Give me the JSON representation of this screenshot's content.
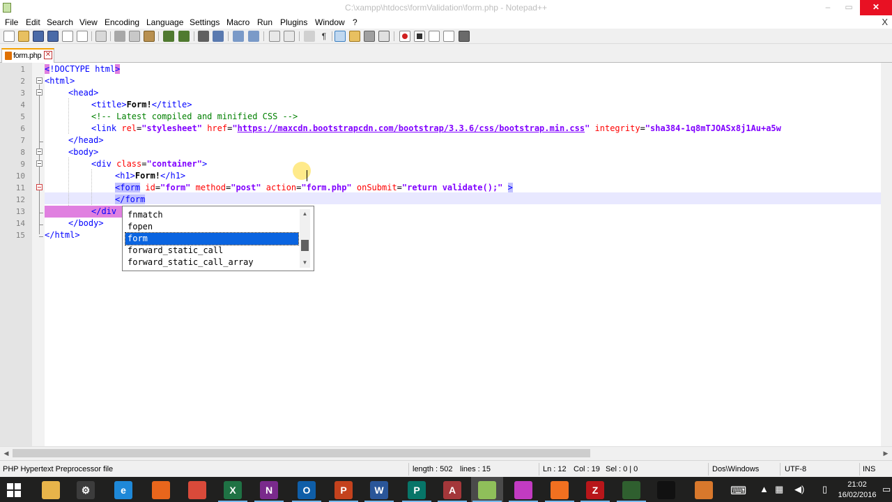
{
  "window": {
    "title": "C:\\xampp\\htdocs\\formValidation\\form.php - Notepad++",
    "min": "–",
    "max": "▭",
    "close": "✕"
  },
  "menu": {
    "items": [
      "File",
      "Edit",
      "Search",
      "View",
      "Encoding",
      "Language",
      "Settings",
      "Macro",
      "Run",
      "Plugins",
      "Window",
      "?"
    ],
    "close_x": "X"
  },
  "toolbar": {
    "icons": [
      "new-file-icon",
      "open-file-icon",
      "save-icon",
      "save-all-icon",
      "close-icon",
      "close-all-icon",
      "print-icon",
      "cut-icon",
      "copy-icon",
      "paste-icon",
      "undo-icon",
      "redo-icon",
      "find-icon",
      "replace-icon",
      "zoom-in-icon",
      "zoom-out-icon",
      "sync-v-icon",
      "sync-h-icon",
      "word-wrap-icon",
      "show-all-chars-icon",
      "indent-guide-icon",
      "user-lang-icon",
      "doc-map-icon",
      "function-list-icon",
      "folder-as-workspace-icon",
      "monitoring-icon",
      "record-macro-icon",
      "stop-macro-icon",
      "play-macro-icon",
      "run-macro-multiple-icon",
      "save-macro-icon"
    ]
  },
  "tab": {
    "label": "form.php",
    "close": "✕"
  },
  "editor": {
    "line_numbers": [
      "1",
      "2",
      "3",
      "4",
      "5",
      "6",
      "7",
      "8",
      "9",
      "10",
      "11",
      "12",
      "13",
      "14",
      "15"
    ],
    "lines": {
      "l1": {
        "open": "<",
        "doctype": "!DOCTYPE html",
        "close": ">"
      },
      "l2": "<html>",
      "l3": "<head>",
      "l4": {
        "open": "<title>",
        "text": "Form!",
        "close": "</title>"
      },
      "l5": "<!-- Latest compiled and minified CSS -->",
      "l6": {
        "tag": "<link ",
        "attr1": "rel",
        "eq1": "=",
        "val1": "\"stylesheet\"",
        "attr2": " href",
        "eq2": "=",
        "q1": "\"",
        "url": "https://maxcdn.bootstrapcdn.com/bootstrap/3.3.6/css/bootstrap.min.css",
        "q2": "\"",
        "attr3": " integrity",
        "eq3": "=",
        "val3": "\"sha384-1q8mTJOASx8j1Au+a5w"
      },
      "l7": "</head>",
      "l8": "<body>",
      "l9": {
        "tag": "<div ",
        "attr": "class",
        "eq": "=",
        "val": "\"container\"",
        "close": ">"
      },
      "l10": {
        "open": "<h1>",
        "text": "Form!",
        "close": "</h1>"
      },
      "l11": {
        "tag": "<form",
        "attr1": " id",
        "eq1": "=",
        "val1": "\"form\"",
        "attr2": " method",
        "eq2": "=",
        "val2": "\"post\"",
        "attr3": " action",
        "eq3": "=",
        "val3": "\"form.php\"",
        "attr4": " onSubmit",
        "eq4": "=",
        "val4": "\"return validate();\"",
        "close": ">"
      },
      "l12": "</form",
      "l13": "</div",
      "l14": "</body>",
      "l15": "</html>"
    }
  },
  "autocomplete": {
    "items": [
      "fnmatch",
      "fopen",
      "form",
      "forward_static_call",
      "forward_static_call_array"
    ],
    "selected": "form",
    "up": "▲",
    "down": "▼"
  },
  "status": {
    "file_type": "PHP Hypertext Preprocessor file",
    "length": "length : 502",
    "lines": "lines : 15",
    "ln": "Ln : 12",
    "col": "Col : 19",
    "sel": "Sel : 0 | 0",
    "eol": "Dos\\Windows",
    "encoding": "UTF-8",
    "mode": "INS"
  },
  "taskbar": {
    "time": "21:02",
    "date": "16/02/2016",
    "icons": [
      {
        "name": "file-explorer-icon",
        "glyph": "",
        "color": "#e8b44a"
      },
      {
        "name": "settings-app-icon",
        "glyph": "⚙",
        "color": "#3c3c3c"
      },
      {
        "name": "internet-explorer-icon",
        "glyph": "e",
        "color": "#1e88d8"
      },
      {
        "name": "firefox-icon",
        "glyph": "",
        "color": "#e8661c"
      },
      {
        "name": "chrome-icon",
        "glyph": "",
        "color": "#d94a3a"
      },
      {
        "name": "excel-icon",
        "glyph": "X",
        "color": "#1f7244"
      },
      {
        "name": "onenote-icon",
        "glyph": "N",
        "color": "#7a2a8c"
      },
      {
        "name": "outlook-icon",
        "glyph": "O",
        "color": "#0f5ea8"
      },
      {
        "name": "powerpoint-icon",
        "glyph": "P",
        "color": "#c4421d"
      },
      {
        "name": "word-icon",
        "glyph": "W",
        "color": "#2a5699"
      },
      {
        "name": "publisher-icon",
        "glyph": "P",
        "color": "#077568"
      },
      {
        "name": "access-icon",
        "glyph": "A",
        "color": "#a4373a"
      },
      {
        "name": "notepad-plus-plus-icon",
        "glyph": "",
        "color": "#8fbf5a"
      },
      {
        "name": "phpstorm-icon",
        "glyph": "",
        "color": "#c23bc2"
      },
      {
        "name": "xampp-icon",
        "glyph": "",
        "color": "#f07020"
      },
      {
        "name": "filezilla-icon",
        "glyph": "Z",
        "color": "#b8161a"
      },
      {
        "name": "terminal-green-icon",
        "glyph": "",
        "color": "#2f5f2f"
      },
      {
        "name": "cmd-icon",
        "glyph": "",
        "color": "#111111"
      },
      {
        "name": "mysql-workbench-icon",
        "glyph": "",
        "color": "#d8782c"
      }
    ]
  }
}
